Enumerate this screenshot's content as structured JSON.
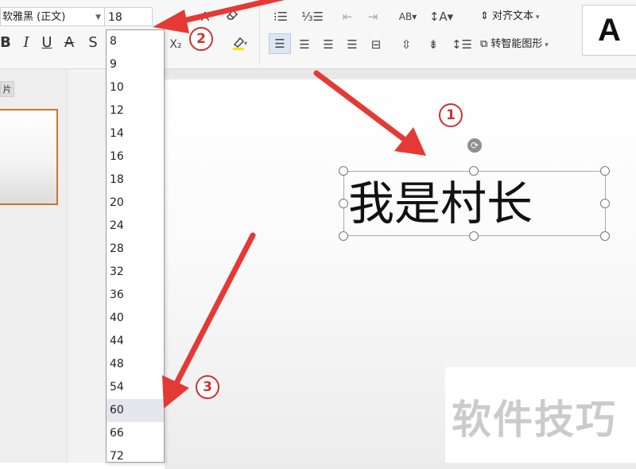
{
  "font": {
    "name": "软雅黑 (正文)",
    "size": "18"
  },
  "format_buttons": [
    {
      "id": "bold",
      "label": "B"
    },
    {
      "id": "italic",
      "label": "I"
    },
    {
      "id": "underline",
      "label": "U"
    },
    {
      "id": "strike-a",
      "label": "A"
    },
    {
      "id": "strikethrough",
      "label": "S"
    }
  ],
  "toolbar": {
    "align_text_label": "对齐文本",
    "smartart_label": "转智能图形",
    "style_preview": "A",
    "subscript": "X₂"
  },
  "sidebar": {
    "tab_label": "片"
  },
  "slide": {
    "text": "我是村长"
  },
  "font_size_options": [
    "8",
    "9",
    "10",
    "12",
    "14",
    "16",
    "18",
    "20",
    "24",
    "28",
    "32",
    "36",
    "40",
    "44",
    "48",
    "54",
    "60",
    "66",
    "72"
  ],
  "selected_option": "60",
  "annotations": {
    "badge1": "1",
    "badge2": "2",
    "badge3": "3"
  },
  "watermark": "软件技巧",
  "colors": {
    "arrow": "#e53935",
    "badge": "#d32f2f",
    "selection_frame": "#c9772d"
  },
  "icons": [
    "font-color-icon",
    "eraser-icon",
    "highlighter-icon",
    "bullet-list-icon",
    "numbered-list-icon",
    "decrease-indent-icon",
    "increase-indent-icon",
    "text-direction-icon",
    "line-spacing-icon",
    "align-left-icon",
    "align-center-icon",
    "align-right-icon",
    "justify-icon",
    "distributed-icon",
    "rotate-icon"
  ]
}
